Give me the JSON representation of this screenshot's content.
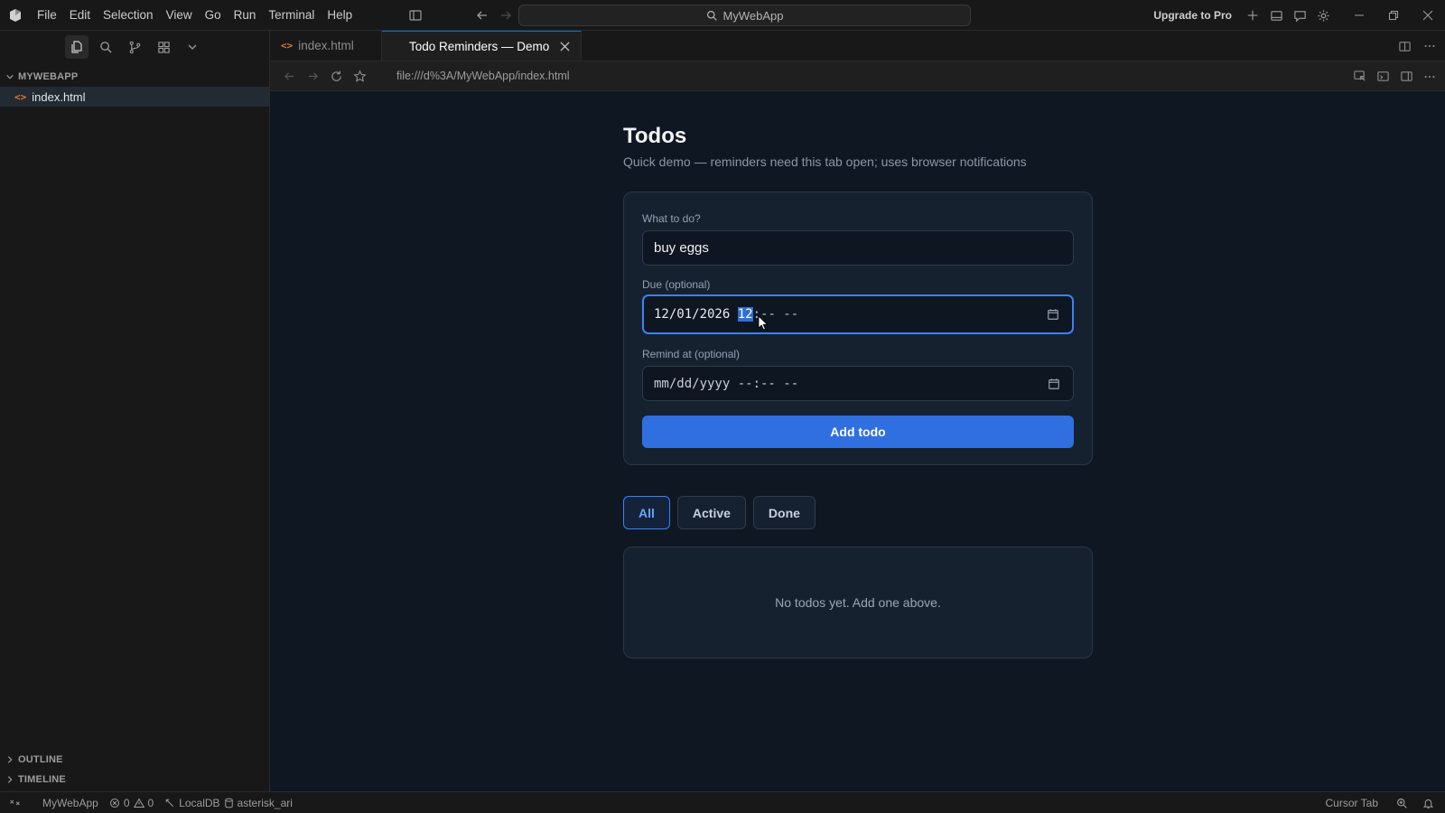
{
  "menu": [
    "File",
    "Edit",
    "Selection",
    "View",
    "Go",
    "Run",
    "Terminal",
    "Help"
  ],
  "command_center": {
    "text": "MyWebApp"
  },
  "title_right": {
    "upgrade": "Upgrade to Pro"
  },
  "sidebar": {
    "folder": "MYWEBAPP",
    "files": [
      {
        "name": "index.html"
      }
    ],
    "outline": "OUTLINE",
    "timeline": "TIMELINE"
  },
  "tabs": [
    {
      "label": "index.html",
      "active": false
    },
    {
      "label": "Todo Reminders — Demo",
      "active": true
    }
  ],
  "browser": {
    "url": "file:///d%3A/MyWebApp/index.html"
  },
  "page": {
    "title": "Todos",
    "subtitle": "Quick demo — reminders need this tab open; uses browser notifications",
    "form": {
      "todo_label": "What to do?",
      "todo_value": "buy eggs",
      "due_label": "Due (optional)",
      "due_date": "12/01/2026",
      "due_hour": "12",
      "due_rest": ":-- --",
      "remind_label": "Remind at (optional)",
      "remind_value": "mm/dd/yyyy --:-- --",
      "add_button": "Add todo"
    },
    "filters": [
      "All",
      "Active",
      "Done"
    ],
    "active_filter": "All",
    "empty_message": "No todos yet. Add one above."
  },
  "statusbar": {
    "project": "MyWebApp",
    "errors": "0",
    "warnings": "0",
    "db": "LocalDB",
    "schema": "asterisk_ari",
    "cursor_tab": "Cursor Tab"
  },
  "colors": {
    "accent": "#2f6fe0",
    "focus_border": "#3b82f6",
    "page_bg": "#0f1722",
    "card_bg": "#162130"
  }
}
